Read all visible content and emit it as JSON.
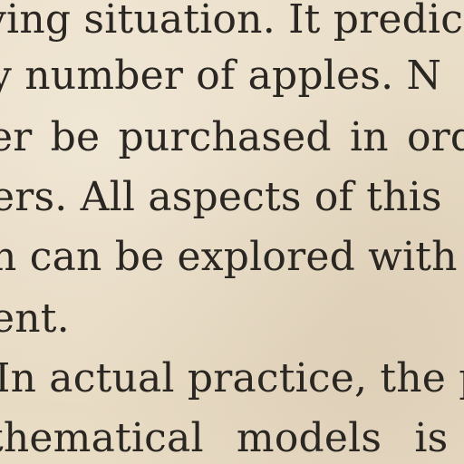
{
  "document": {
    "lines": [
      "ying situation. It predic",
      "y number of apples. N",
      "er be purchased in ord",
      "ers. All aspects of this",
      "n can be explored with",
      "ent.",
      "In actual practice, the p",
      "thematical models is"
    ]
  }
}
